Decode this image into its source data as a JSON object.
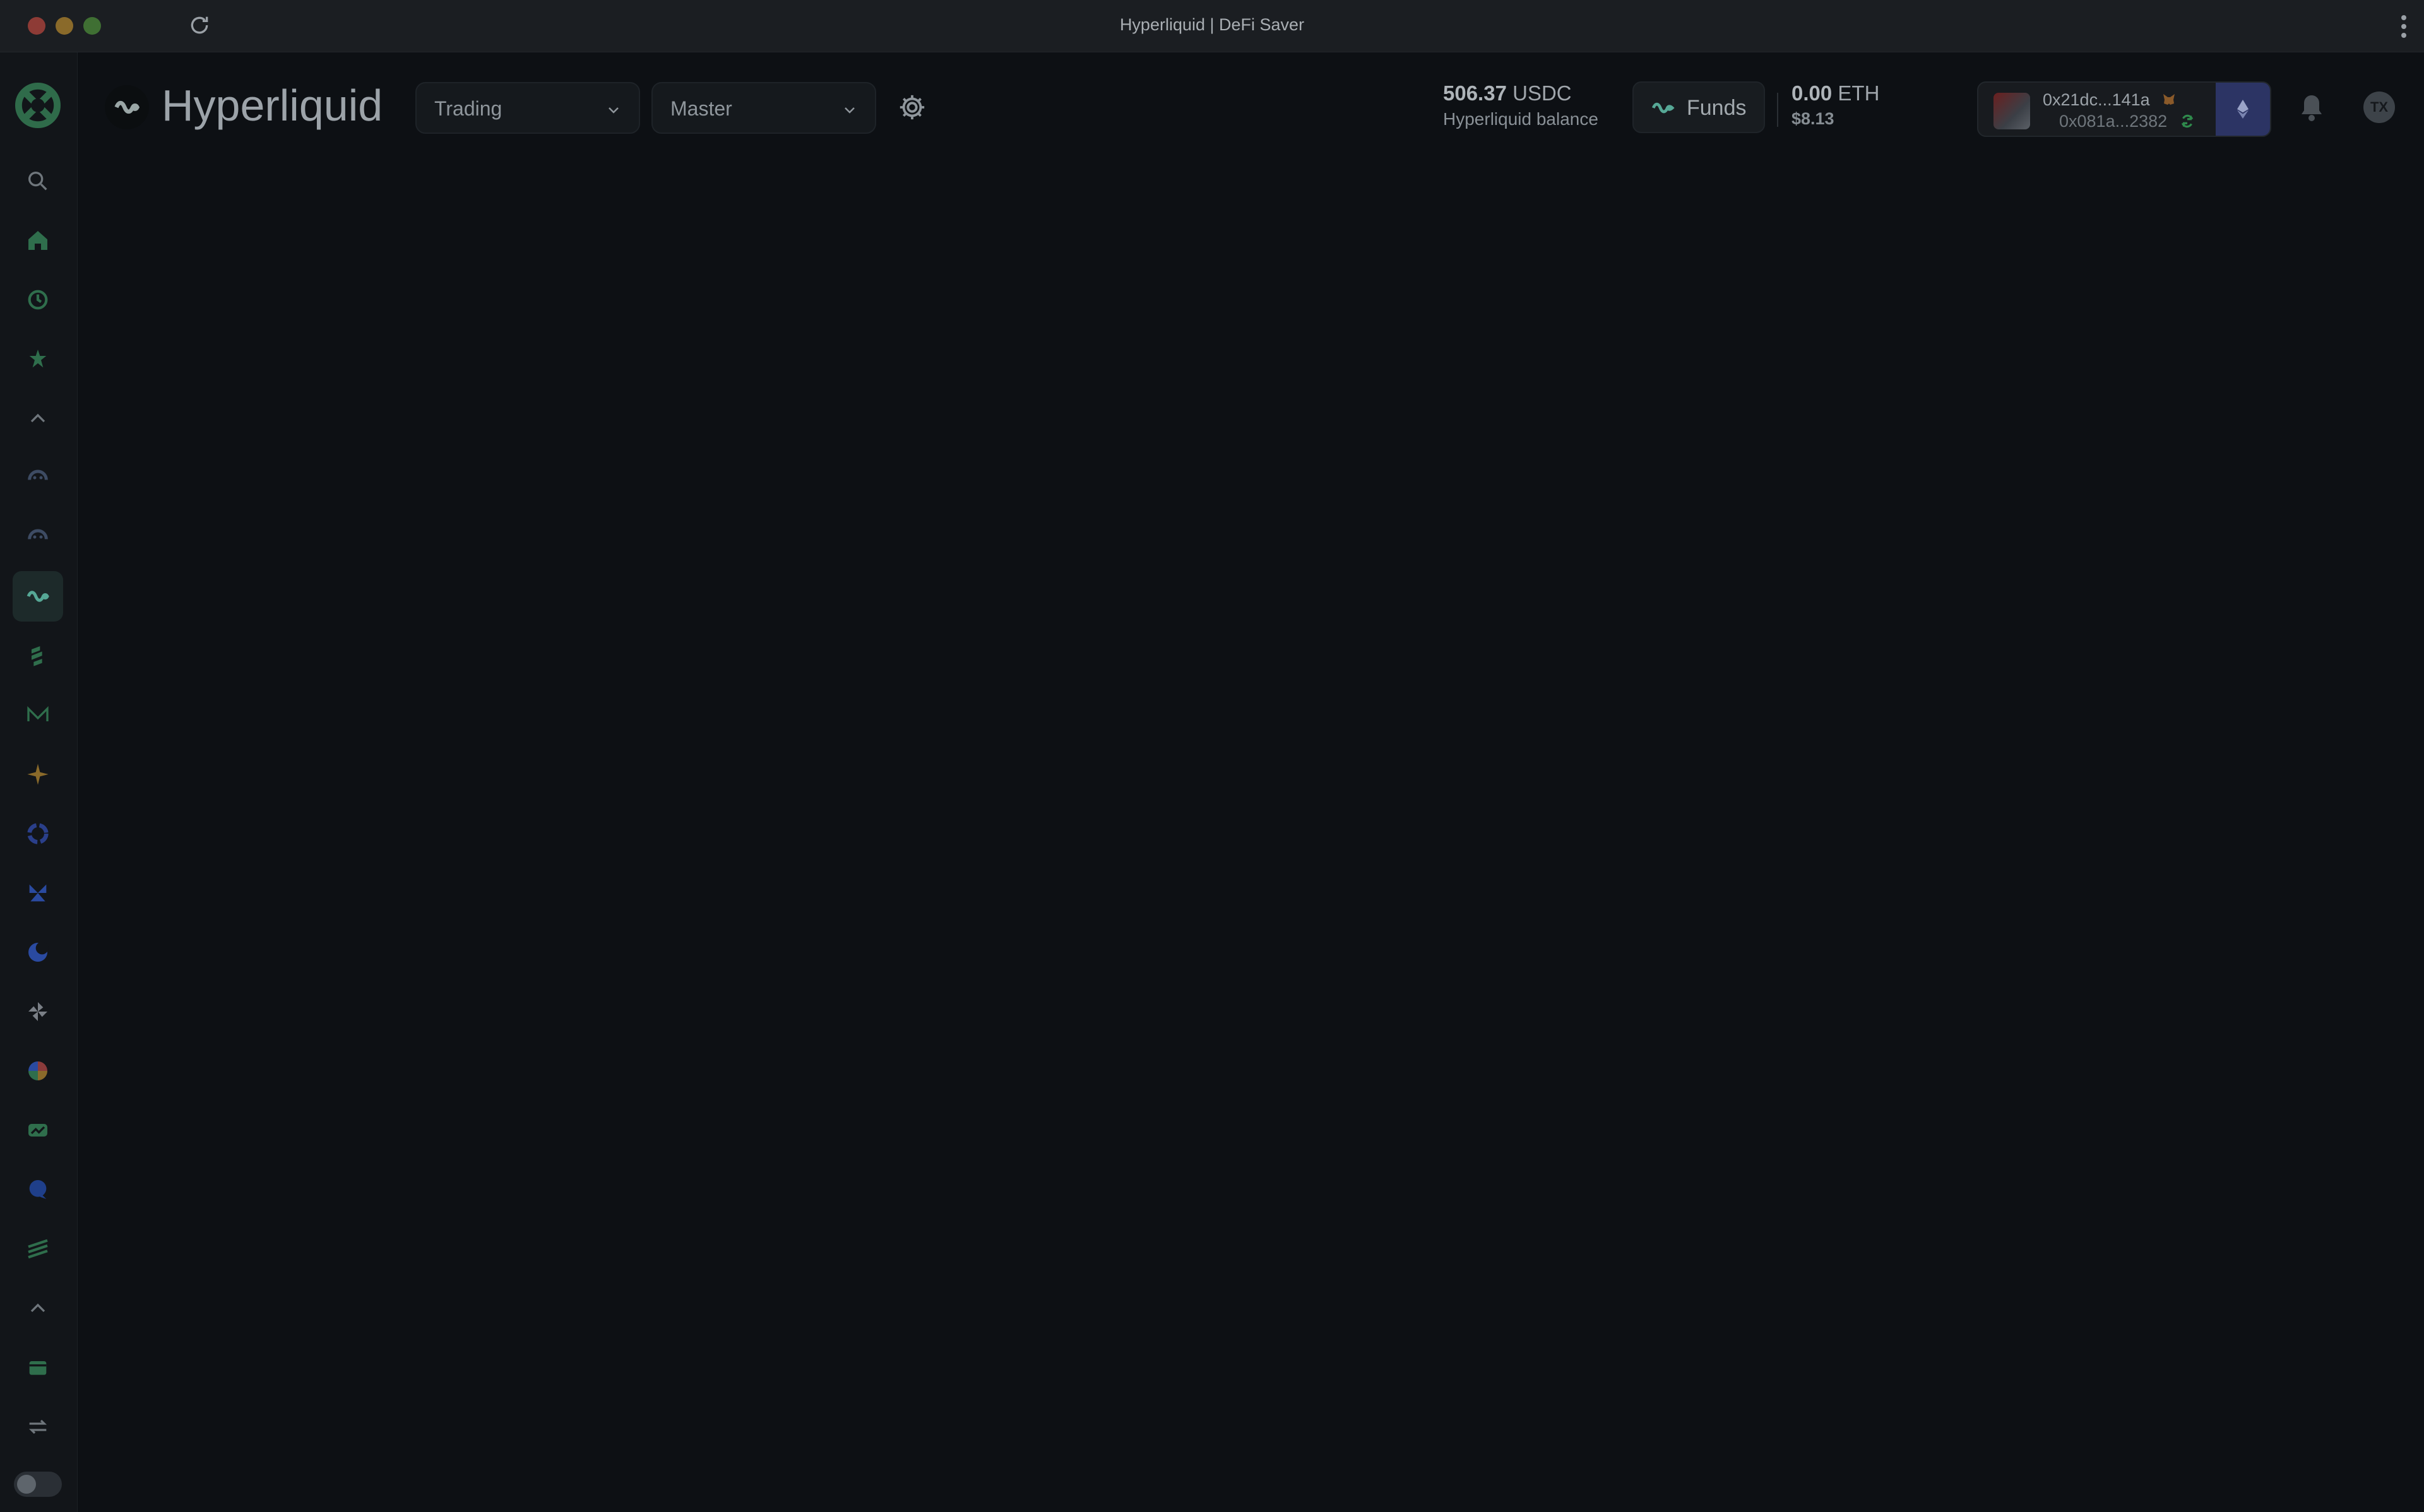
{
  "window": {
    "title": "Hyperliquid | DeFi Saver"
  },
  "header": {
    "page_title": "Hyperliquid",
    "mode_dropdown": {
      "value": "Trading"
    },
    "account_dropdown": {
      "value": "Master"
    },
    "balance": {
      "amount": "506.37",
      "unit": "USDC",
      "label": "Hyperliquid balance"
    },
    "funds_button": "Funds",
    "eth": {
      "amount": "0.00",
      "unit": "ETH",
      "usd": "$8.13"
    },
    "wallet": {
      "address_primary": "0x21dc...141a",
      "address_secondary": "0x081a...2382"
    },
    "tx_label": "TX",
    "clipboard_count": "0"
  },
  "sidebar": {
    "items": [
      "search-icon",
      "home-icon",
      "recent-icon",
      "simulation-icon",
      "collapse-up-icon",
      "protocol-v3-icon",
      "protocol-v4-icon",
      "hyperliquid-icon",
      "protocol-stack-icon",
      "protocol-m-icon",
      "protocol-star-icon",
      "protocol-ring-icon",
      "protocol-butterfly-icon",
      "protocol-crescent-icon",
      "protocol-pinwheel-icon",
      "protocol-pie-icon",
      "protocol-chart-icon",
      "protocol-chat-icon",
      "protocol-stripes-icon",
      "collapse-up-icon",
      "wallet-icon",
      "swap-icon"
    ]
  },
  "colors": {
    "accent": "#3ddc84",
    "background": "#0d1014",
    "network": "#2c3464"
  }
}
